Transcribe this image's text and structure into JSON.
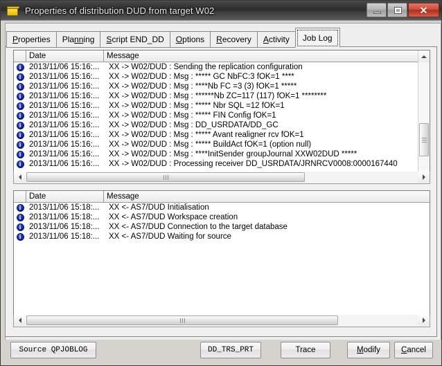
{
  "window": {
    "title": "Properties of distribution DUD from target W02",
    "icon": "folder-icon",
    "controls": {
      "minimize": "minimize-icon",
      "maximize": "maximize-icon",
      "close": "✕"
    }
  },
  "tabs": [
    {
      "label": "Properties",
      "accel": "P",
      "active": false
    },
    {
      "label": "Planning",
      "accel": "nn",
      "active": false
    },
    {
      "label": "Script END_DD",
      "accel": "S",
      "active": false
    },
    {
      "label": "Options",
      "accel": "O",
      "active": false
    },
    {
      "label": "Recovery",
      "accel": "R",
      "active": false
    },
    {
      "label": "Activity",
      "accel": "A",
      "active": false
    },
    {
      "label": "Job Log",
      "accel": "",
      "active": true
    }
  ],
  "top_list": {
    "columns": [
      "",
      "Date",
      "Message"
    ],
    "rows": [
      {
        "icon": "info-icon",
        "date": "2013/11/06 15:16:...",
        "message": "XX -> W02/DUD : Sending the replication configuration"
      },
      {
        "icon": "info-icon",
        "date": "2013/11/06 15:16:...",
        "message": "XX -> W02/DUD : Msg : ***** GC  NbFC:3  fOK=1 ****"
      },
      {
        "icon": "info-icon",
        "date": "2013/11/06 15:16:...",
        "message": "XX -> W02/DUD : Msg : ****Nb FC =3 (3) fOK=1 *****"
      },
      {
        "icon": "info-icon",
        "date": "2013/11/06 15:16:...",
        "message": "XX -> W02/DUD : Msg : ******Nb ZC=117 (117) fOK=1 ********"
      },
      {
        "icon": "info-icon",
        "date": "2013/11/06 15:16:...",
        "message": "XX -> W02/DUD : Msg : ***** Nbr SQL =12 fOK=1"
      },
      {
        "icon": "info-icon",
        "date": "2013/11/06 15:16:...",
        "message": "XX -> W02/DUD : Msg : ***** FIN Config fOK=1"
      },
      {
        "icon": "info-icon",
        "date": "2013/11/06 15:16:...",
        "message": "XX -> W02/DUD : Msg : DD_USRDATA/DD_GC"
      },
      {
        "icon": "info-icon",
        "date": "2013/11/06 15:16:...",
        "message": "XX -> W02/DUD : Msg : ***** Avant realigner rcv fOK=1"
      },
      {
        "icon": "info-icon",
        "date": "2013/11/06 15:16:...",
        "message": "XX -> W02/DUD : Msg : ***** BuildAct fOK=1 (option null)"
      },
      {
        "icon": "info-icon",
        "date": "2013/11/06 15:16:...",
        "message": "XX -> W02/DUD : Msg : ****InitSender groupJournal XXW02DUD *****"
      },
      {
        "icon": "info-icon",
        "date": "2013/11/06 15:16:...",
        "message": "XX -> W02/DUD : Processing receiver DD_USRDATA/JRNRCV0008:0000167440"
      }
    ]
  },
  "bottom_list": {
    "columns": [
      "",
      "Date",
      "Message"
    ],
    "rows": [
      {
        "icon": "info-icon",
        "date": "2013/11/06 15:18:...",
        "message": "XX <- AS7/DUD Initialisation"
      },
      {
        "icon": "info-icon",
        "date": "2013/11/06 15:18:...",
        "message": "XX <- AS7/DUD Workspace creation"
      },
      {
        "icon": "info-icon",
        "date": "2013/11/06 15:18:...",
        "message": "XX <- AS7/DUD Connection to the target database"
      },
      {
        "icon": "info-icon",
        "date": "2013/11/06 15:18:...",
        "message": "XX <- AS7/DUD Waiting for source"
      }
    ]
  },
  "buttons": {
    "source": "Source QPJOBLOG",
    "trs_prt": "DD_TRS_PRT",
    "trace": "Trace",
    "modify": "Modify",
    "modify_accel": "M",
    "cancel": "Cancel",
    "cancel_accel": "C"
  },
  "colors": {
    "titlebar": "#2b2b2b",
    "close_button": "#ad2d1c",
    "dialog_face": "#d6d3ce",
    "list_background": "#ffffff",
    "info_icon": "#0d1f9e"
  }
}
